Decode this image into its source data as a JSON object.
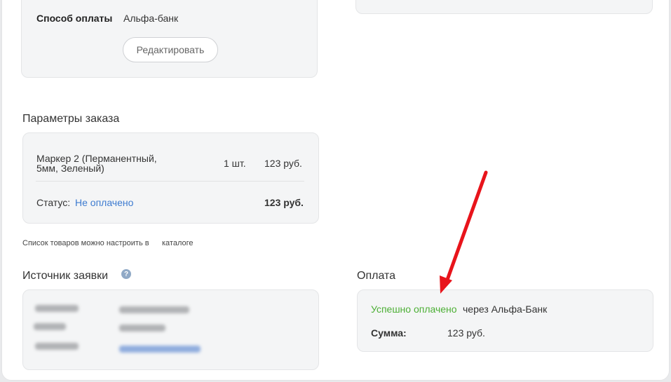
{
  "payment_method_card": {
    "label": "Способ оплаты",
    "value": "Альфа-банк",
    "edit_button": "Редактировать"
  },
  "order": {
    "title": "Параметры заказа",
    "item": {
      "name_line1": "Маркер 2 (Перманентный,",
      "name_line2": "5мм, Зеленый)",
      "qty": "1 шт.",
      "price": "123 руб."
    },
    "status_label": "Статус:",
    "status_value": "Не оплачено",
    "total": "123 руб.",
    "catalog_note": "Список товаров можно настроить в",
    "catalog_link": "каталоге"
  },
  "source": {
    "title": "Источник заявки",
    "help_icon": "?"
  },
  "payment": {
    "title": "Оплата",
    "status_success": "Успешно оплачено",
    "via_text": "через Альфа-Банк",
    "sum_label": "Сумма:",
    "sum_value": "123 руб."
  },
  "colors": {
    "link": "#3d7bd0",
    "success": "#4caf35",
    "annotation_arrow": "#e8141b"
  }
}
